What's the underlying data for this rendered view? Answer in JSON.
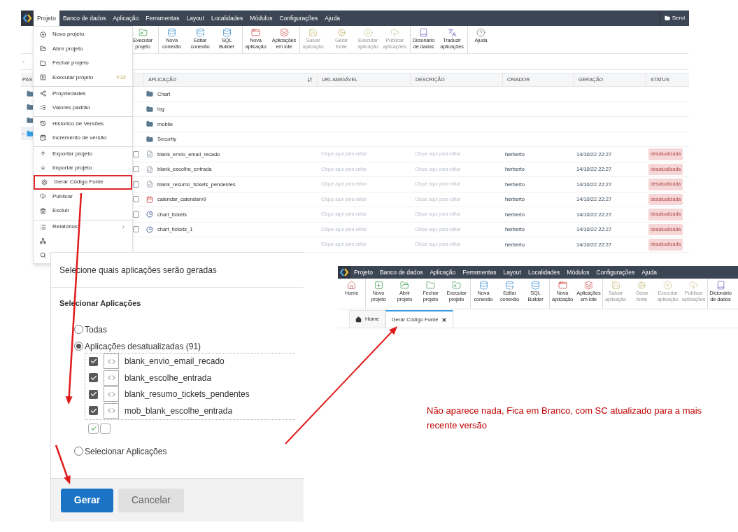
{
  "main_window": {
    "menu_bar": [
      {
        "label": "Projeto",
        "selected": true
      },
      {
        "label": "Banco de dados",
        "selected": false
      },
      {
        "label": "Aplicação",
        "selected": false
      },
      {
        "label": "Ferramentas",
        "selected": false
      },
      {
        "label": "Layout",
        "selected": false
      },
      {
        "label": "Localidades",
        "selected": false
      },
      {
        "label": "Módulos",
        "selected": false
      },
      {
        "label": "Configurações",
        "selected": false
      },
      {
        "label": "Ajuda",
        "selected": false
      }
    ],
    "server_button": "Servi",
    "toolbar": [
      {
        "label": "Executar\nprojeto",
        "disabled": false,
        "divider_before": false
      },
      {
        "label": "Nova\nconexão",
        "disabled": false,
        "divider_before": true
      },
      {
        "label": "Editar\nconexão",
        "disabled": false,
        "divider_before": false
      },
      {
        "label": "SQL\nBuilder",
        "disabled": false,
        "divider_before": false
      },
      {
        "label": "Nova\naplicação",
        "disabled": false,
        "divider_before": true
      },
      {
        "label": "Aplicações\nem lote",
        "disabled": false,
        "divider_before": false
      },
      {
        "label": "Salvar\naplicação",
        "disabled": true,
        "divider_before": true
      },
      {
        "label": "Gerar\nfonte",
        "disabled": true,
        "divider_before": false
      },
      {
        "label": "Executar\naplicação",
        "disabled": true,
        "divider_before": false
      },
      {
        "label": "Publicar\naplicações",
        "disabled": true,
        "divider_before": false
      },
      {
        "label": "Dicionário\nde dados",
        "disabled": false,
        "divider_before": true
      },
      {
        "label": "Traduzir\naplicações",
        "disabled": false,
        "divider_before": false
      },
      {
        "label": "Ajuda",
        "disabled": false,
        "divider_before": true
      }
    ],
    "folders": {
      "header": "PAS",
      "items": [
        {
          "selected": false
        },
        {
          "selected": false
        },
        {
          "selected": false
        },
        {
          "selected": true
        }
      ]
    },
    "table": {
      "columns": [
        "APLICAÇÃO",
        "URL AMIGÁVEL",
        "DESCRIÇÃO",
        "CRIADOR",
        "GERAÇÃO",
        "STATUS"
      ],
      "rows": [
        {
          "kind": "folder",
          "name": "Chart"
        },
        {
          "kind": "folder",
          "name": "log"
        },
        {
          "kind": "folder",
          "name": "mobile"
        },
        {
          "kind": "folder",
          "name": "Security"
        },
        {
          "kind": "blank",
          "checked": false,
          "name": "blank_envio_email_recado",
          "url": "Clique aqui para editar",
          "description": "Clique aqui para editar",
          "creator": "herberto",
          "generated": "14/10/22 22:27",
          "status": "desatualizada"
        },
        {
          "kind": "blank",
          "checked": false,
          "name": "blank_escolhe_entrada",
          "url": "Clique aqui para editar",
          "description": "Clique aqui para editar",
          "creator": "herberto",
          "generated": "14/10/22 22:27",
          "status": "desatualizada"
        },
        {
          "kind": "blank",
          "checked": false,
          "name": "blank_resumo_tickets_pendentes",
          "url": "Clique aqui para editar",
          "description": "Clique aqui para editar",
          "creator": "herberto",
          "generated": "14/10/22 22:27",
          "status": "desatualizada"
        },
        {
          "kind": "calendar",
          "checked": false,
          "name": "calendar_calendarv9",
          "url": "Clique aqui para editar",
          "description": "Clique aqui para editar",
          "creator": "herberto",
          "generated": "14/10/22 22:27",
          "status": "desatualizada"
        },
        {
          "kind": "chart",
          "checked": false,
          "name": "chart_tickets",
          "url": "Clique aqui para editar",
          "description": "Clique aqui para editar",
          "creator": "herberto",
          "generated": "14/10/22 22:27",
          "status": "desatualizada"
        },
        {
          "kind": "chart",
          "checked": false,
          "name": "chart_tickets_1",
          "url": "Clique aqui para editar",
          "description": "Clique aqui para editar",
          "creator": "herberto",
          "generated": "14/10/22 22:27",
          "status": "desatualizada"
        },
        {
          "kind": "blank",
          "url": "Clique aqui para editar",
          "description": "Clique aqui para editar",
          "creator": "herberto",
          "generated": "14/10/22 22:27",
          "status": "desatualizada"
        }
      ]
    }
  },
  "project_menu": [
    {
      "label": "Novo projeto",
      "divider_before": false,
      "annotated": false,
      "submenu": false
    },
    {
      "label": "Abrir projeto",
      "divider_before": false,
      "annotated": false,
      "submenu": false
    },
    {
      "label": "Fechar projeto",
      "divider_before": false,
      "annotated": false,
      "submenu": false
    },
    {
      "label": "Executar projeto",
      "shortcut": "F12",
      "divider_before": false,
      "annotated": false,
      "submenu": false
    },
    {
      "label": "Propriedades",
      "divider_before": true,
      "annotated": false,
      "submenu": false
    },
    {
      "label": "Valores padrão",
      "divider_before": false,
      "annotated": false,
      "submenu": false
    },
    {
      "label": "Histórico de Versões",
      "divider_before": true,
      "annotated": false,
      "submenu": false
    },
    {
      "label": "Incremento de versão",
      "divider_before": false,
      "annotated": false,
      "submenu": false
    },
    {
      "label": "Exportar projeto",
      "divider_before": true,
      "annotated": false,
      "submenu": false
    },
    {
      "label": "Importar projeto",
      "divider_before": false,
      "annotated": false,
      "submenu": false
    },
    {
      "label": "Gerar Código Fonte",
      "divider_before": false,
      "annotated": true,
      "submenu": false
    },
    {
      "label": "Publicar",
      "divider_before": false,
      "annotated": false,
      "submenu": false
    },
    {
      "label": "Excluir",
      "divider_before": false,
      "annotated": false,
      "submenu": false
    },
    {
      "label": "Relatórios",
      "divider_before": true,
      "annotated": false,
      "submenu": true
    }
  ],
  "dialog": {
    "title": "Selecione quais aplicações serão geradas",
    "section": "Selecionar Aplicações",
    "options": [
      {
        "label": "Todas",
        "selected": false
      },
      {
        "label": "Aplicações desatualizadas (91)",
        "selected": true,
        "applications": [
          {
            "name": "blank_envio_email_recado",
            "checked": true
          },
          {
            "name": "blank_escolhe_entrada",
            "checked": true
          },
          {
            "name": "blank_resumo_tickets_pendentes",
            "checked": true
          },
          {
            "name": "mob_blank_escolhe_entrada",
            "checked": true
          }
        ]
      },
      {
        "label": "Selecionar Aplicações",
        "selected": false
      }
    ],
    "buttons": [
      {
        "label": "Gerar",
        "kind": "primary"
      },
      {
        "label": "Cancelar",
        "kind": "secondary"
      }
    ]
  },
  "second_window": {
    "menu_bar": [
      {
        "label": "Projeto",
        "selected": false
      },
      {
        "label": "Banco de dados",
        "selected": false
      },
      {
        "label": "Aplicação",
        "selected": false
      },
      {
        "label": "Ferramentas",
        "selected": false
      },
      {
        "label": "Layout",
        "selected": false
      },
      {
        "label": "Localidades",
        "selected": false
      },
      {
        "label": "Módulos",
        "selected": false
      },
      {
        "label": "Configurações",
        "selected": false
      },
      {
        "label": "Ajuda",
        "selected": false
      }
    ],
    "toolbar": [
      {
        "label": "Home",
        "disabled": false,
        "divider_before": false
      },
      {
        "label": "Novo\nprojeto",
        "disabled": false,
        "divider_before": true
      },
      {
        "label": "Abrir\nprojeto",
        "disabled": false,
        "divider_before": false
      },
      {
        "label": "Fechar\nprojeto",
        "disabled": false,
        "divider_before": false
      },
      {
        "label": "Executar\nprojeto",
        "disabled": false,
        "divider_before": false
      },
      {
        "label": "Nova\nconexão",
        "disabled": false,
        "divider_before": true
      },
      {
        "label": "Editar\nconexão",
        "disabled": false,
        "divider_before": false
      },
      {
        "label": "SQL\nBuilder",
        "disabled": false,
        "divider_before": false
      },
      {
        "label": "Nova\naplicação",
        "disabled": false,
        "divider_before": true
      },
      {
        "label": "Aplicações\nem lote",
        "disabled": false,
        "divider_before": false
      },
      {
        "label": "Salvar\naplicação",
        "disabled": true,
        "divider_before": true
      },
      {
        "label": "Gerar\nfonte",
        "disabled": true,
        "divider_before": false
      },
      {
        "label": "Executar\naplicação",
        "disabled": true,
        "divider_before": false
      },
      {
        "label": "Publicar\naplicações",
        "disabled": true,
        "divider_before": false
      },
      {
        "label": "Dicionário\nde dados",
        "disabled": false,
        "divider_before": true
      }
    ],
    "tabs": [
      {
        "label": "Home",
        "selected": false,
        "closable": false
      },
      {
        "label": "Gerar Código Fonte",
        "selected": true,
        "closable": true
      }
    ]
  },
  "note": "Não aparece nada, Fica em Branco, com SC atualizado para a mais recente versão"
}
